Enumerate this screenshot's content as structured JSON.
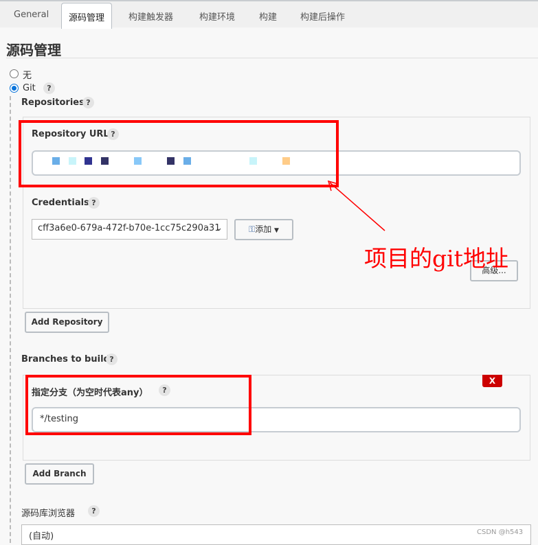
{
  "tabs": [
    {
      "label": "General"
    },
    {
      "label": "源码管理"
    },
    {
      "label": "构建触发器"
    },
    {
      "label": "构建环境"
    },
    {
      "label": "构建"
    },
    {
      "label": "构建后操作"
    }
  ],
  "section_title": "源码管理",
  "scm": {
    "options": [
      {
        "label": "无",
        "selected": false
      },
      {
        "label": "Git",
        "selected": true
      }
    ],
    "help": "?"
  },
  "repositories": {
    "label": "Repositories",
    "url_label": "Repository URL",
    "credentials_label": "Credentials",
    "credentials_value": "cff3a6e0-679a-472f-b70e-1cc75c290a31",
    "add_label": "添加",
    "advanced_label": "高级...",
    "add_repository_label": "Add Repository"
  },
  "branches": {
    "label": "Branches to build",
    "delete_label": "X",
    "specifier_label": "指定分支（为空时代表any）",
    "specifier_value": "*/testing",
    "add_branch_label": "Add Branch"
  },
  "browser": {
    "label": "源码库浏览器",
    "value": "(自动)"
  },
  "annotation": {
    "text": "项目的git地址",
    "color": "#ff0000"
  },
  "watermark": "CSDN @h543",
  "colors": {
    "accent": "#0a74da",
    "delete": "#cc0000",
    "annotation": "#ff0000"
  }
}
